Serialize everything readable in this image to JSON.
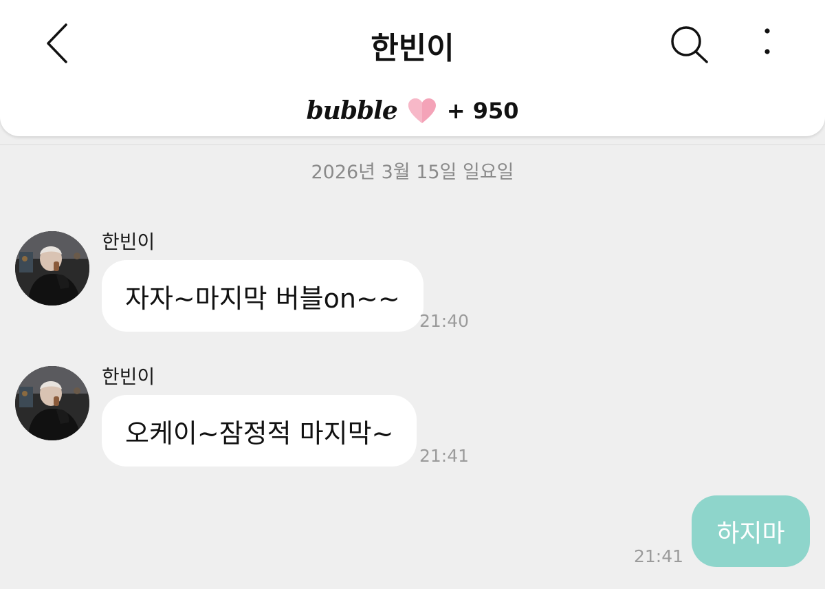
{
  "header": {
    "title": "한빈이",
    "back_icon": "chevron-left-icon",
    "search_icon": "search-icon",
    "more_icon": "more-vertical-icon",
    "brand": "bubble",
    "heart_icon": "heart-icon",
    "heart_color": "#f4a3b8",
    "heart_count": "+ 950"
  },
  "date": "2026년 3월 15일 일요일",
  "messages": [
    {
      "sender": "한빈이",
      "text": "자자~마지막 버블on~~",
      "time": "21:40"
    },
    {
      "sender": "한빈이",
      "text": "오케이~잠정적 마지막~",
      "time": "21:41"
    }
  ],
  "my_message": {
    "text": "하지마",
    "time": "21:41",
    "color": "#8ed5cb"
  }
}
